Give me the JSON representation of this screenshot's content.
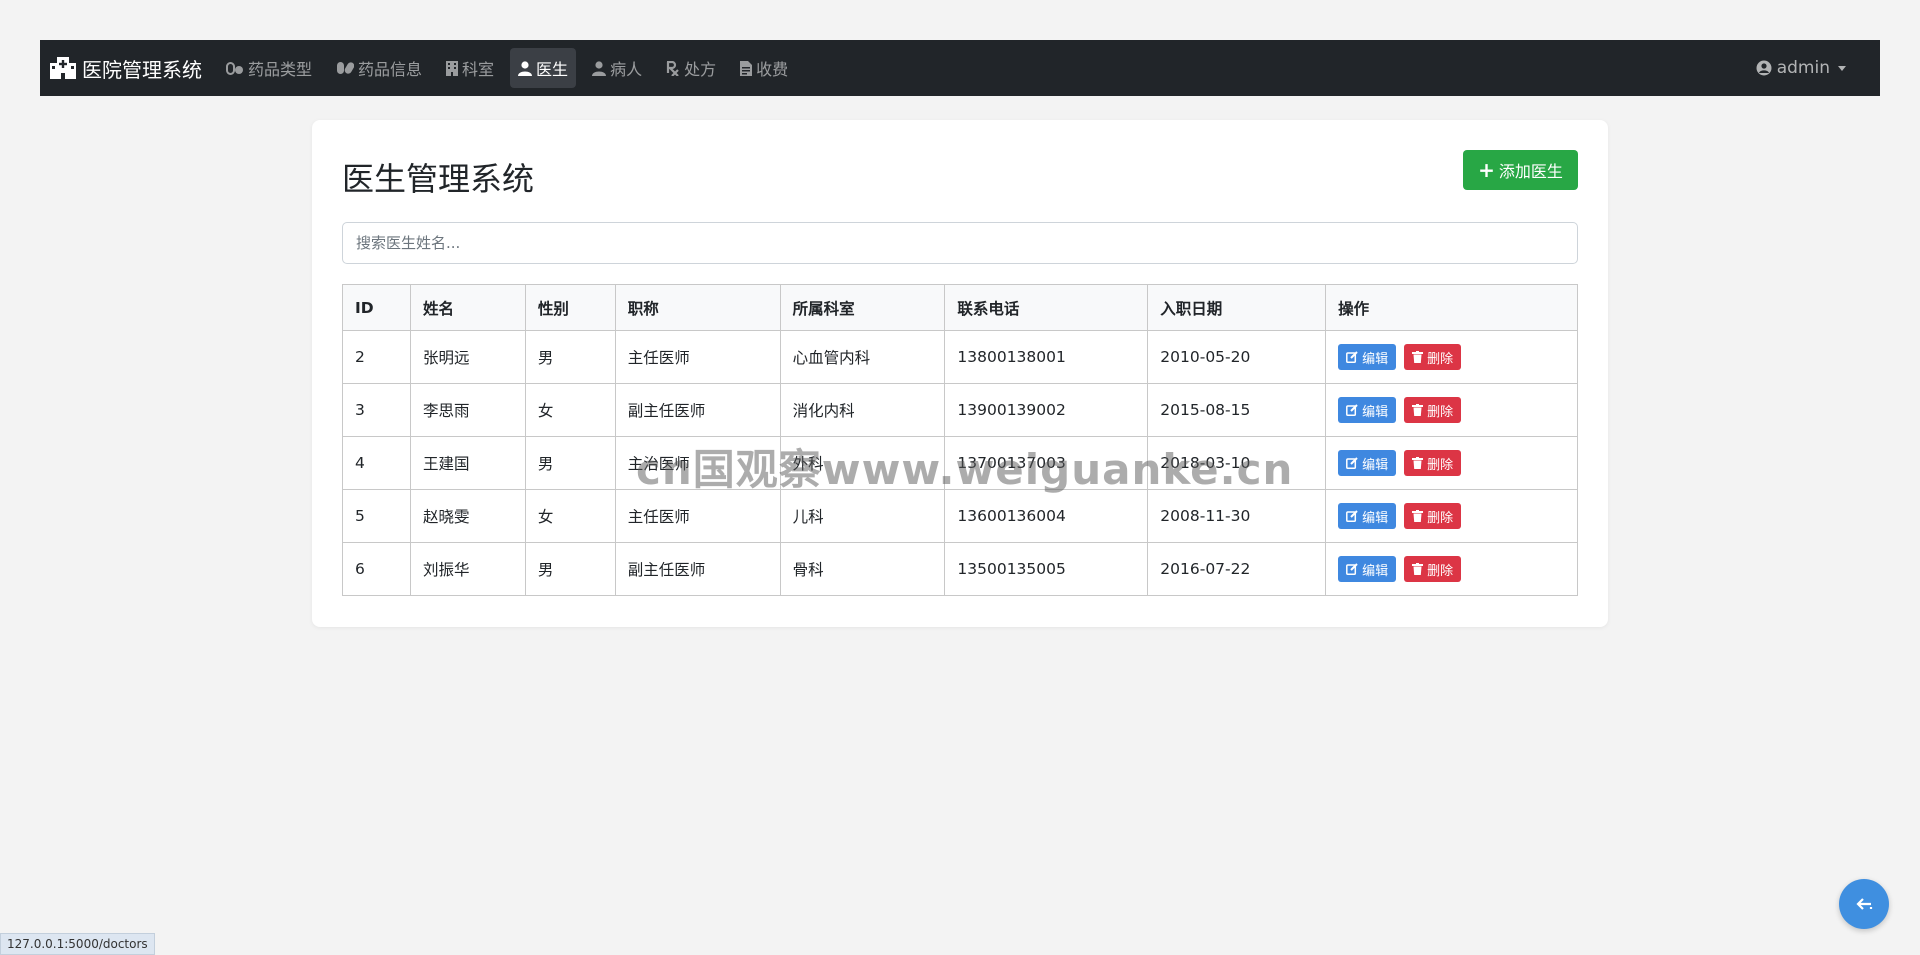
{
  "nav": {
    "brand": "医院管理系统",
    "items": [
      {
        "label": "药品类型",
        "icon": "pills-icon"
      },
      {
        "label": "药品信息",
        "icon": "capsules-icon"
      },
      {
        "label": "科室",
        "icon": "building-icon"
      },
      {
        "label": "医生",
        "icon": "user-doctor-icon",
        "active": true
      },
      {
        "label": "病人",
        "icon": "user-injured-icon"
      },
      {
        "label": "处方",
        "icon": "prescription-icon"
      },
      {
        "label": "收费",
        "icon": "invoice-icon"
      }
    ],
    "user": "admin"
  },
  "page": {
    "title": "医生管理系统",
    "add_button": "添加医生",
    "search_placeholder": "搜索医生姓名..."
  },
  "table": {
    "headers": [
      "ID",
      "姓名",
      "性别",
      "职称",
      "所属科室",
      "联系电话",
      "入职日期",
      "操作"
    ],
    "edit_label": "编辑",
    "delete_label": "删除",
    "rows": [
      [
        "2",
        "张明远",
        "男",
        "主任医师",
        "心血管内科",
        "13800138001",
        "2010-05-20"
      ],
      [
        "3",
        "李思雨",
        "女",
        "副主任医师",
        "消化内科",
        "13900139002",
        "2015-08-15"
      ],
      [
        "4",
        "王建国",
        "男",
        "主治医师",
        "外科",
        "13700137003",
        "2018-03-10"
      ],
      [
        "5",
        "赵晓雯",
        "女",
        "主任医师",
        "儿科",
        "13600136004",
        "2008-11-30"
      ],
      [
        "6",
        "刘振华",
        "男",
        "副主任医师",
        "骨科",
        "13500135005",
        "2016-07-22"
      ]
    ]
  },
  "watermark": "cn国观察www.weiguanke.cn",
  "status_url": "127.0.0.1:5000/doctors",
  "colors": {
    "navbar": "#212529",
    "success": "#28a745",
    "primary": "#3f88e0",
    "danger": "#dc3545"
  }
}
